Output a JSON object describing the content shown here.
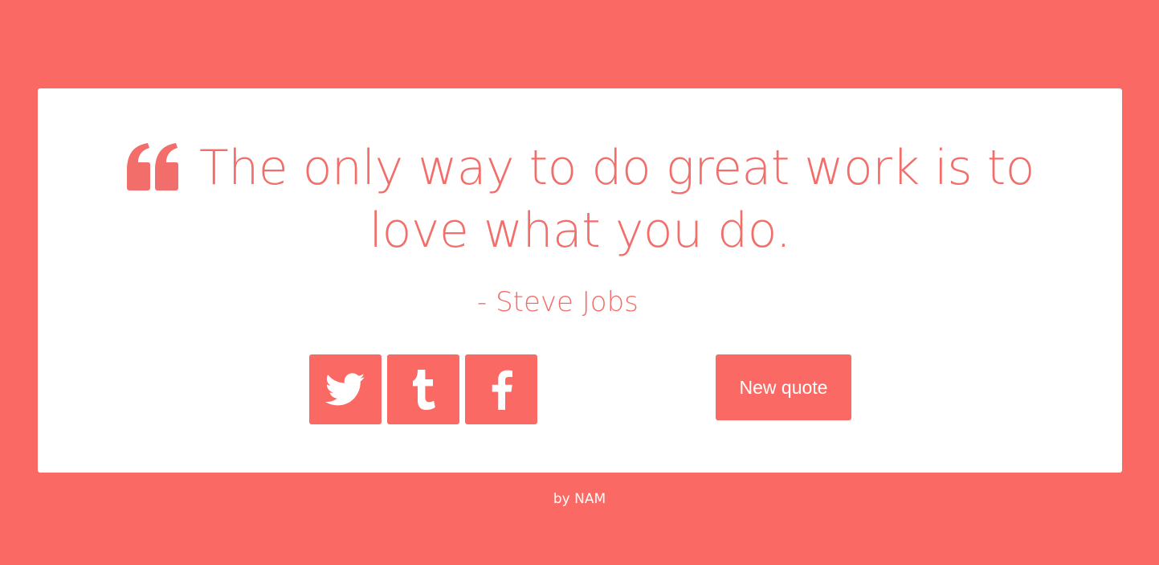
{
  "quote": {
    "text": "The only way to do great work is to love what you do.",
    "author": "- Steve Jobs",
    "icon": "quote-left-icon"
  },
  "social": [
    {
      "name": "twitter",
      "icon": "twitter-icon"
    },
    {
      "name": "tumblr",
      "icon": "tumblr-icon"
    },
    {
      "name": "facebook",
      "icon": "facebook-icon"
    }
  ],
  "actions": {
    "new_quote_label": "New quote"
  },
  "footer": {
    "text": "by NAM"
  },
  "colors": {
    "accent": "#FB6964",
    "card": "#FFFFFF"
  }
}
